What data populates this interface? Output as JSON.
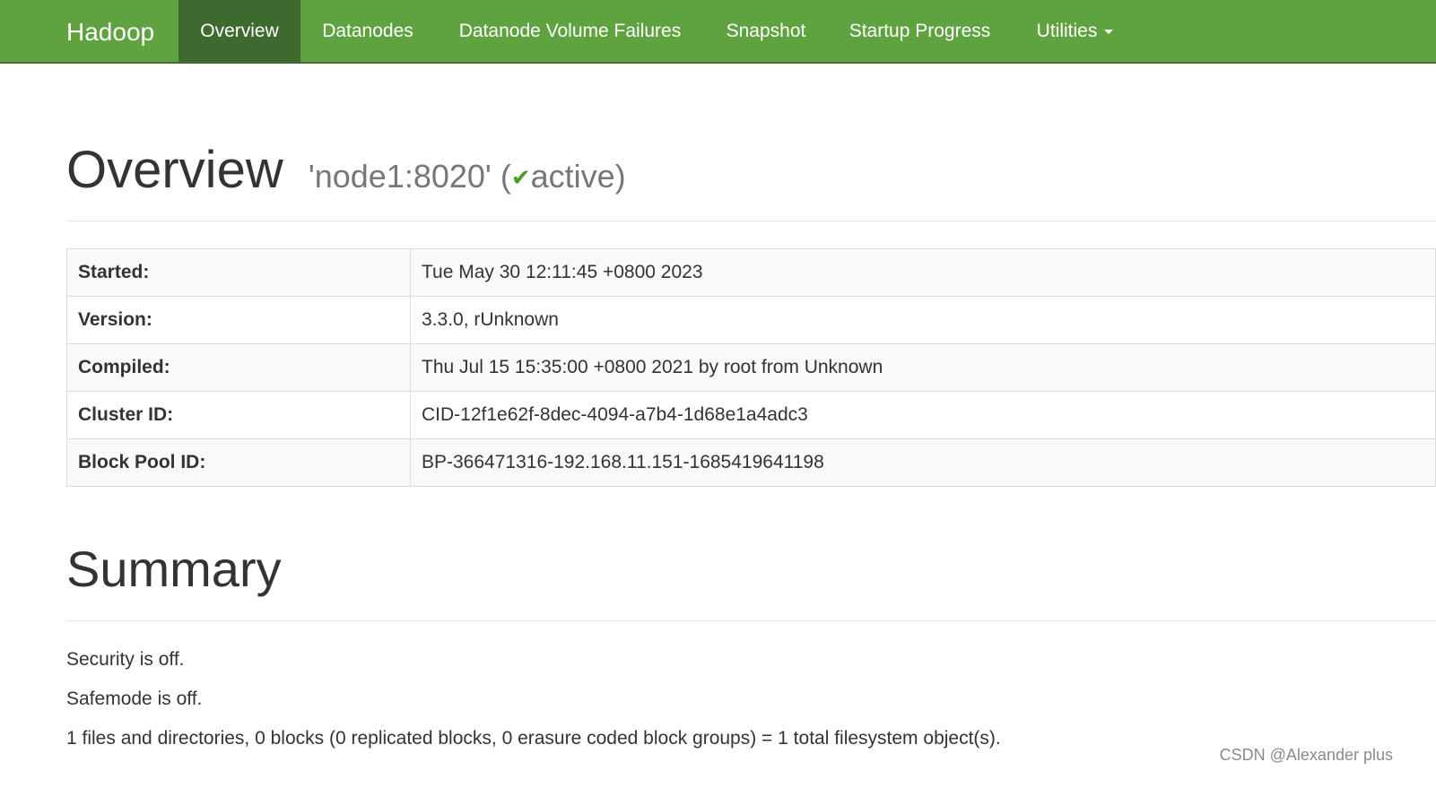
{
  "navbar": {
    "brand": "Hadoop",
    "items": [
      {
        "label": "Overview",
        "active": true
      },
      {
        "label": "Datanodes"
      },
      {
        "label": "Datanode Volume Failures"
      },
      {
        "label": "Snapshot"
      },
      {
        "label": "Startup Progress"
      },
      {
        "label": "Utilities"
      }
    ],
    "color": "#5fa341",
    "active_color": "#3f6a2f"
  },
  "overview": {
    "title": "Overview",
    "node": "'node1:8020'",
    "paren_open": "(",
    "status": "active",
    "paren_close": ")",
    "status_icon": "checkmark-icon"
  },
  "info_table": [
    {
      "key": "Started:",
      "value": "Tue May 30 12:11:45 +0800 2023"
    },
    {
      "key": "Version:",
      "value": "3.3.0, rUnknown"
    },
    {
      "key": "Compiled:",
      "value": "Thu Jul 15 15:35:00 +0800 2021 by root from Unknown"
    },
    {
      "key": "Cluster ID:",
      "value": "CID-12f1e62f-8dec-4094-a7b4-1d68e1a4adc3"
    },
    {
      "key": "Block Pool ID:",
      "value": "BP-366471316-192.168.11.151-1685419641198"
    }
  ],
  "summary": {
    "title": "Summary",
    "security": "Security is off.",
    "safemode": "Safemode is off.",
    "objects": "1 files and directories, 0 blocks (0 replicated blocks, 0 erasure coded block groups) = 1 total filesystem object(s)."
  },
  "watermark": "CSDN @Alexander plus"
}
